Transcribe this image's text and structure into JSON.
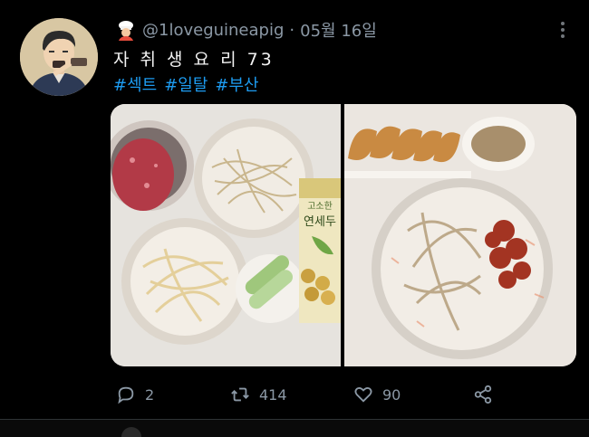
{
  "tweet": {
    "handle": "@1loveguineapig",
    "separator": "·",
    "date": "05월 16일",
    "text": "자 취 생 요 리 73",
    "hashtags": [
      "#섹트",
      "#일탈",
      "#부산"
    ],
    "avatar_icon": "cartoon-man-avatar",
    "badge_icon": "chef-emoji-icon"
  },
  "media": {
    "left_photo": {
      "description_icon": "ingredients-photo",
      "package_text_top": "고소한",
      "package_text_main": "연세두"
    },
    "right_photo": {
      "description_icon": "plated-noodles-photo"
    }
  },
  "actions": {
    "reply_count": "2",
    "retweet_count": "414",
    "like_count": "90"
  },
  "colors": {
    "background": "#000000",
    "link": "#1d9bf0",
    "muted": "#8b98a5"
  }
}
